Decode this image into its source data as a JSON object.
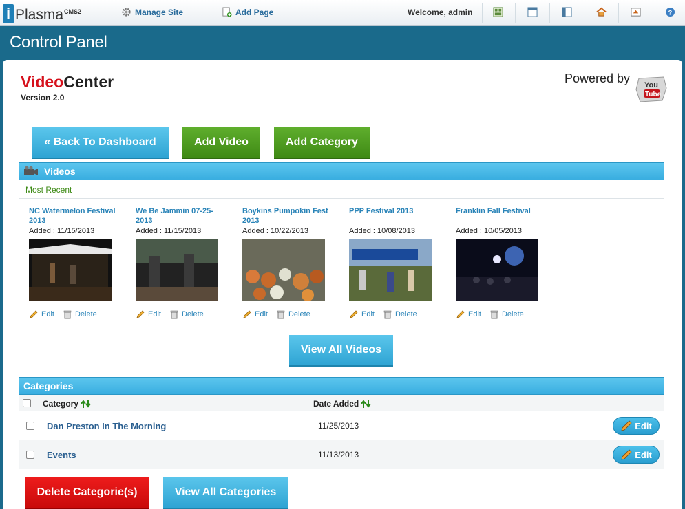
{
  "topbar": {
    "logo_text": "Plasma",
    "logo_sup": "CMS2",
    "manage_site": "Manage Site",
    "add_page": "Add Page",
    "welcome": "Welcome, admin"
  },
  "control_panel_title": "Control Panel",
  "app": {
    "title_red": "Video",
    "title_dark": "Center",
    "version": "Version 2.0",
    "powered_by": "Powered by"
  },
  "buttons": {
    "back": "« Back To Dashboard",
    "add_video": "Add Video",
    "add_category": "Add Category",
    "view_all_videos": "View All Videos",
    "delete_categories": "Delete Categorie(s)",
    "view_all_categories": "View All Categories"
  },
  "videos": {
    "heading": "Videos",
    "subheading": "Most Recent",
    "edit_label": "Edit",
    "delete_label": "Delete",
    "items": [
      {
        "title": "NC Watermelon Festival 2013",
        "added": "Added : 11/15/2013"
      },
      {
        "title": "We Be Jammin 07-25-2013",
        "added": "Added : 11/15/2013"
      },
      {
        "title": "Boykins Pumpokin Fest 2013",
        "added": "Added : 10/22/2013"
      },
      {
        "title": "PPP Festival 2013",
        "added": "Added : 10/08/2013"
      },
      {
        "title": "Franklin Fall Festival",
        "added": "Added : 10/05/2013"
      }
    ]
  },
  "categories": {
    "heading": "Categories",
    "col_category": "Category",
    "col_date": "Date Added",
    "edit_label": "Edit",
    "rows": [
      {
        "name": "Dan Preston In The Morning",
        "date": "11/25/2013"
      },
      {
        "name": "Events",
        "date": "11/13/2013"
      }
    ]
  },
  "colors": {
    "accent_blue": "#39aee0",
    "brand_teal": "#1a6a8b",
    "green": "#4f9c22",
    "red": "#d6111c"
  }
}
